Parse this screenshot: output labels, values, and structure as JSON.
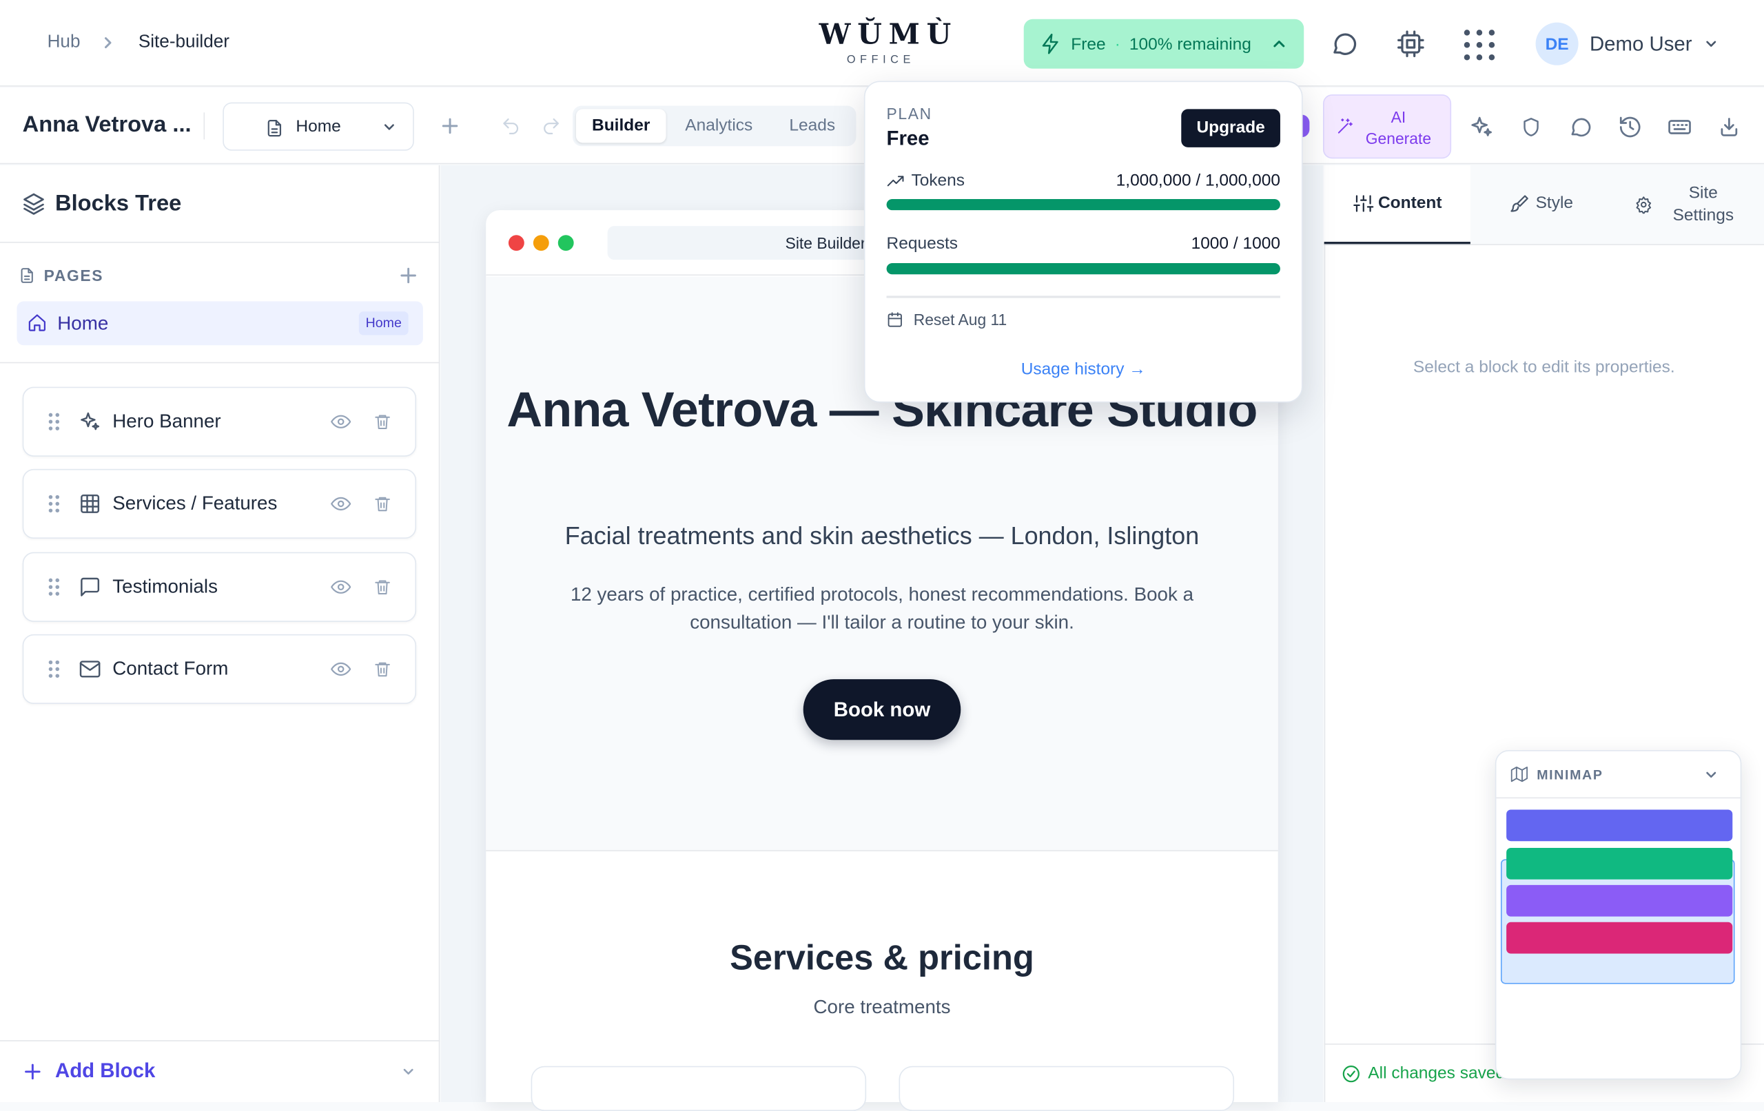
{
  "header": {
    "breadcrumb": {
      "root": "Hub",
      "current": "Site-builder"
    },
    "logo": {
      "main": "WŬMÙ",
      "sub": "OFFICE"
    },
    "plan_button": {
      "plan": "Free",
      "separator": "·",
      "remaining": "100% remaining"
    },
    "user": {
      "initials": "DE",
      "name": "Demo User"
    }
  },
  "toolbar": {
    "project_name": "Anna Vetrova ...",
    "page_select": "Home",
    "tabs": [
      "Builder",
      "Analytics",
      "Leads"
    ],
    "active_tab": "Builder",
    "ai_generate": {
      "line1": "AI",
      "line2": "Generate"
    }
  },
  "plan_popover": {
    "plan_label": "PLAN",
    "plan_name": "Free",
    "upgrade_label": "Upgrade",
    "tokens": {
      "label": "Tokens",
      "value": "1,000,000 / 1,000,000",
      "fraction": 1.0
    },
    "requests": {
      "label": "Requests",
      "value": "1000 / 1000",
      "fraction": 1.0
    },
    "reset": "Reset Aug 11",
    "history_link": "Usage history →"
  },
  "left_panel": {
    "title": "Blocks Tree",
    "pages_label": "PAGES",
    "pages": [
      {
        "label": "Home",
        "badge": "Home"
      }
    ],
    "blocks": [
      {
        "label": "Hero Banner",
        "icon": "sparkles-icon"
      },
      {
        "label": "Services / Features",
        "icon": "grid-icon"
      },
      {
        "label": "Testimonials",
        "icon": "message-icon"
      },
      {
        "label": "Contact Form",
        "icon": "mail-icon"
      }
    ],
    "add_block": "Add Block"
  },
  "canvas": {
    "url_bar": "Site Builder",
    "hero": {
      "title": "Anna Vetrova — Skincare Studio",
      "subtitle": "Facial treatments and skin aesthetics — London, Islington",
      "description": "12 years of practice, certified protocols, honest recommendations. Book a consultation — I'll tailor a routine to your skin.",
      "cta": "Book now"
    },
    "services": {
      "title": "Services & pricing",
      "subtitle": "Core treatments"
    }
  },
  "right_panel": {
    "tabs": [
      {
        "label": "Content",
        "icon": "sliders-icon"
      },
      {
        "label": "Style",
        "icon": "brush-icon"
      },
      {
        "label": "Site Settings",
        "icon": "gear-icon"
      }
    ],
    "active_tab": "Content",
    "empty_message": "Select a block to edit its properties.",
    "status": "All changes saved"
  },
  "minimap": {
    "label": "MINIMAP",
    "bars": [
      {
        "color": "#6366f1"
      },
      {
        "color": "#10b981"
      },
      {
        "color": "#8b5cf6"
      },
      {
        "color": "#db2777"
      }
    ]
  },
  "colors": {
    "accent": "#4f46e5",
    "plan_bg": "#a7f3d0",
    "plan_text": "#047857",
    "progress": "#059669",
    "dark": "#0f172a"
  }
}
